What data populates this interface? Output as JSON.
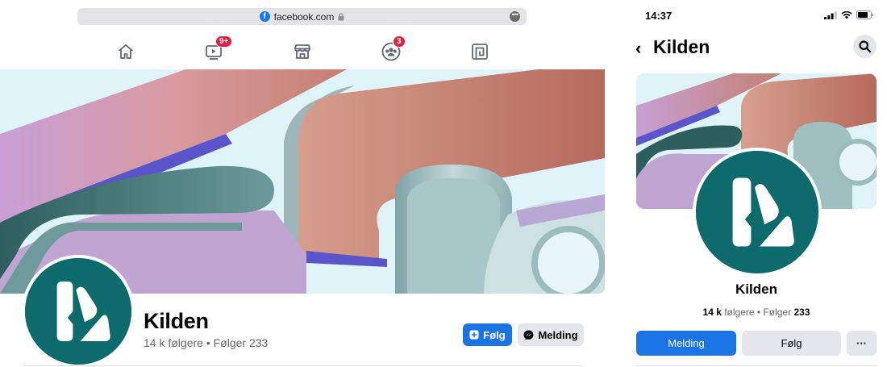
{
  "tablet": {
    "url": "facebook.com",
    "url_favicon": "f",
    "url_more": "•••",
    "nav": [
      {
        "name": "home-icon"
      },
      {
        "name": "watch-icon",
        "badge": "9+"
      },
      {
        "name": "marketplace-icon"
      },
      {
        "name": "groups-icon",
        "badge": "3"
      },
      {
        "name": "gaming-icon"
      }
    ],
    "page_name": "Kilden",
    "followers": "14 k følgere • Følger 233",
    "follow_label": "Følg",
    "message_label": "Melding"
  },
  "phone": {
    "time": "14:37",
    "back": "‹",
    "title": "Kilden",
    "page_name": "Kilden",
    "followers_count": "14 k",
    "followers_word": " følgere • Følger ",
    "following_count": "233",
    "message_label": "Melding",
    "follow_label": "Følg",
    "more_label": "···"
  },
  "colors": {
    "brand_blue": "#1b74e4",
    "badge_red": "#e41e3f",
    "logo_teal": "#0d6b6b",
    "cover_bg": "#dff4f9"
  }
}
